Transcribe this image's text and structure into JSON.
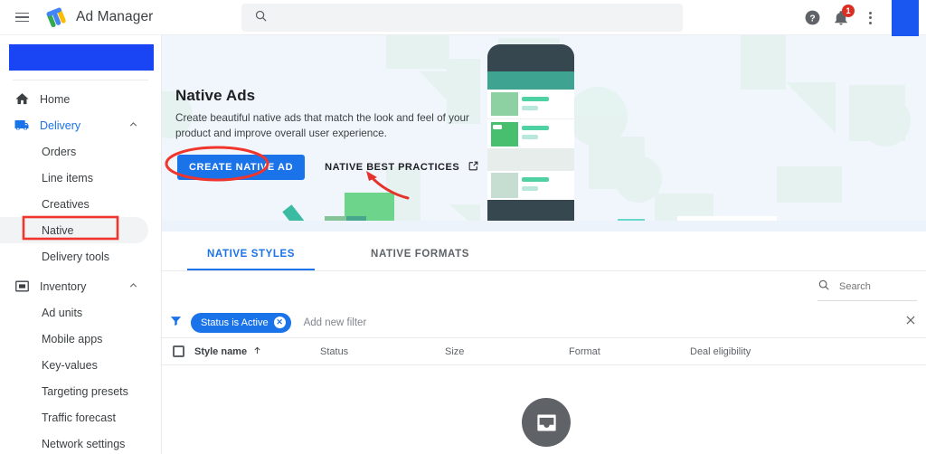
{
  "app": {
    "name": "Ad Manager"
  },
  "header": {
    "menu_icon": "hamburger-menu-icon",
    "logo_icon": "ad-manager-logo-icon",
    "search_placeholder": "",
    "search_value": "",
    "search_icon": "search-icon",
    "help_icon": "help-icon",
    "notifications_icon": "bell-icon",
    "notifications_count": "1",
    "more_icon": "kebab-menu-icon",
    "avatar": "account-avatar"
  },
  "sidebar": {
    "account_block": "",
    "items": [
      {
        "label": "Home",
        "icon": "home-icon",
        "level": "top",
        "state": "default"
      },
      {
        "label": "Delivery",
        "icon": "truck-icon",
        "level": "top",
        "state": "expanded-active",
        "chevron": "chevron-up-icon"
      },
      {
        "label": "Orders",
        "icon": "",
        "level": "child",
        "state": "default"
      },
      {
        "label": "Line items",
        "icon": "",
        "level": "child",
        "state": "default"
      },
      {
        "label": "Creatives",
        "icon": "",
        "level": "child",
        "state": "default"
      },
      {
        "label": "Native",
        "icon": "",
        "level": "child",
        "state": "selected"
      },
      {
        "label": "Delivery tools",
        "icon": "",
        "level": "child",
        "state": "default"
      },
      {
        "label": "Inventory",
        "icon": "inventory-icon",
        "level": "top",
        "state": "expanded",
        "chevron": "chevron-up-icon"
      },
      {
        "label": "Ad units",
        "icon": "",
        "level": "child",
        "state": "default"
      },
      {
        "label": "Mobile apps",
        "icon": "",
        "level": "child",
        "state": "default"
      },
      {
        "label": "Key-values",
        "icon": "",
        "level": "child",
        "state": "default"
      },
      {
        "label": "Targeting presets",
        "icon": "",
        "level": "child",
        "state": "default"
      },
      {
        "label": "Traffic forecast",
        "icon": "",
        "level": "child",
        "state": "default"
      },
      {
        "label": "Network settings",
        "icon": "",
        "level": "child",
        "state": "default"
      }
    ]
  },
  "hero": {
    "title": "Native Ads",
    "description": "Create beautiful native ads that match the look and feel of your product and improve overall user experience.",
    "primary_button": "CREATE NATIVE AD",
    "secondary_button": "NATIVE BEST PRACTICES",
    "external_link_icon": "external-link-icon",
    "illustration": "native-ads-phone-illustration"
  },
  "tabs": [
    {
      "label": "NATIVE STYLES",
      "active": true
    },
    {
      "label": "NATIVE FORMATS",
      "active": false
    }
  ],
  "toolbar": {
    "search_placeholder": "Search",
    "search_value": "",
    "search_icon": "search-icon"
  },
  "filters": {
    "filter_icon": "filter-funnel-icon",
    "chips": [
      {
        "label": "Status is Active",
        "remove_icon": "chip-remove-icon"
      }
    ],
    "add_filter_label": "Add new filter",
    "close_icon": "close-icon"
  },
  "table": {
    "select_all": "select-all-checkbox",
    "columns": [
      {
        "label": "Style name",
        "sort": "ascending",
        "sort_icon": "arrow-up-icon"
      },
      {
        "label": "Status"
      },
      {
        "label": "Size"
      },
      {
        "label": "Format"
      },
      {
        "label": "Deal eligibility"
      }
    ],
    "rows": [],
    "empty_state_icon": "inbox-empty-icon"
  },
  "annotations": [
    {
      "type": "oval",
      "target": "CREATE NATIVE AD",
      "color": "#f0352d"
    },
    {
      "type": "box",
      "target": "Native",
      "color": "#f0352d"
    },
    {
      "type": "arrow",
      "target": "NATIVE BEST PRACTICES",
      "color": "#e5322b"
    }
  ],
  "colors": {
    "accent_blue": "#1a73e8",
    "account_blue": "#1a45f5",
    "hero_bg": "#f1f6fc",
    "annotation_red": "#f0352d",
    "badge_red": "#d93025"
  }
}
